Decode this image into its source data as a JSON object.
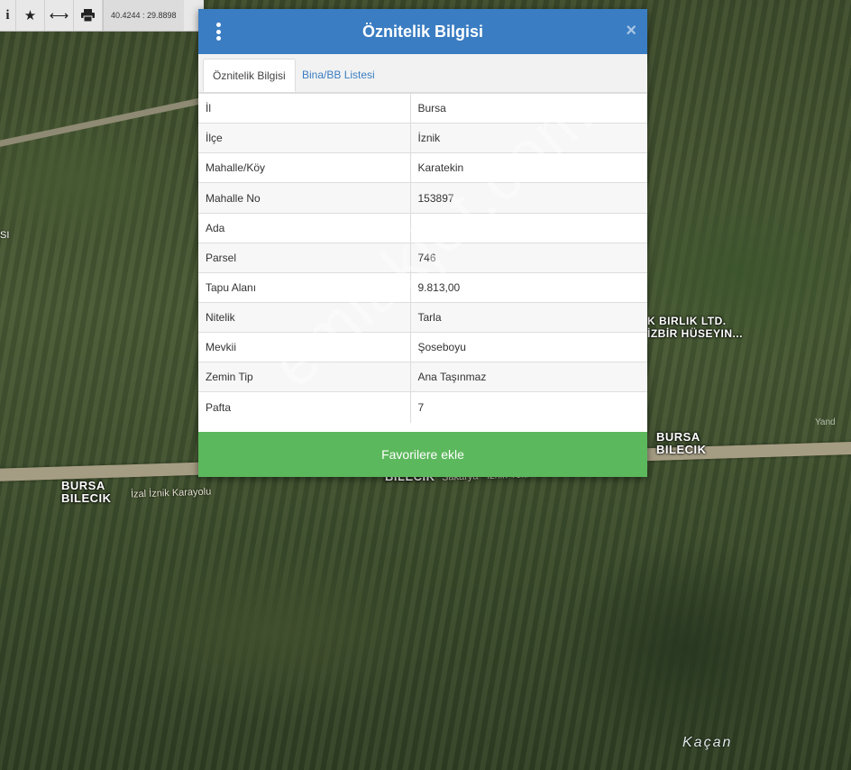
{
  "map": {
    "labels": [
      {
        "text": "BURSA\nBILECIK",
        "pos": "left"
      },
      {
        "text": "BILECIK",
        "pos": "center"
      },
      {
        "text": "BURSA\nBILECIK",
        "pos": "right"
      },
      {
        "text": "K BIRLIK LTD.\nİZBİR HÜSEYIN...",
        "pos": "company"
      }
    ],
    "road_labels": [
      "İzal İznik Karayolu",
      "Sakarya - İznik Yolu"
    ],
    "place_label": "Kaçan",
    "yandex": "Yand",
    "left_edge": "SI"
  },
  "toolbar": {
    "icons": [
      "info-icon",
      "star-icon",
      "arrows-horizontal-icon",
      "print-icon"
    ],
    "info_glyph": "i",
    "star_glyph": "★",
    "arrows_glyph": "⟷",
    "print_glyph": "⎙",
    "coordinates": "40.4244 : 29.8898"
  },
  "modal": {
    "title": "Öznitelik Bilgisi",
    "close_glyph": "×",
    "tabs": [
      {
        "label": "Öznitelik Bilgisi",
        "active": true
      },
      {
        "label": "Bina/BB Listesi",
        "active": false
      }
    ],
    "rows": [
      {
        "key": "İl",
        "value": "Bursa"
      },
      {
        "key": "İlçe",
        "value": "İznik"
      },
      {
        "key": "Mahalle/Köy",
        "value": "Karatekin"
      },
      {
        "key": "Mahalle No",
        "value": "153897"
      },
      {
        "key": "Ada",
        "value": ""
      },
      {
        "key": "Parsel",
        "value": "746"
      },
      {
        "key": "Tapu Alanı",
        "value": "9.813,00"
      },
      {
        "key": "Nitelik",
        "value": "Tarla"
      },
      {
        "key": "Mevkii",
        "value": "Şoseboyu"
      },
      {
        "key": "Zemin Tip",
        "value": "Ana Taşınmaz"
      },
      {
        "key": "Pafta",
        "value": "7"
      }
    ],
    "button_label": "Favorilere ekle"
  },
  "watermark": "emlakjet.com",
  "colors": {
    "header": "#3a7dc2",
    "button": "#5cb85c",
    "tab_link": "#3a7dc2"
  }
}
